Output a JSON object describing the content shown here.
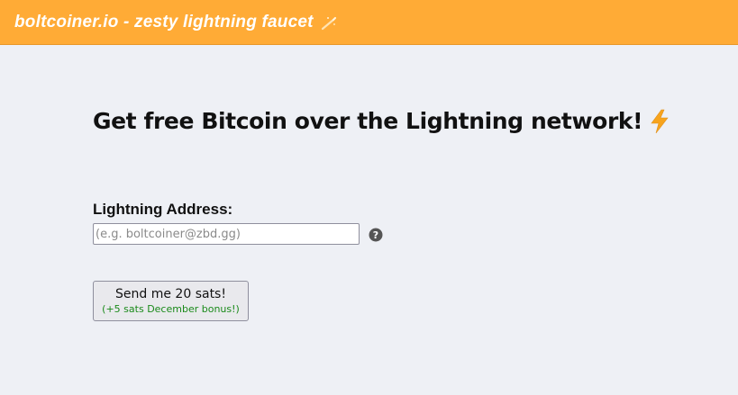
{
  "header": {
    "brand_text": "boltcoiner.io - zesty lightning faucet",
    "brand_icon": "wand-icon",
    "background_color": "#ffab36"
  },
  "main": {
    "headline": "Get free Bitcoin over the Lightning network!",
    "headline_icon": "lightning-bolt-icon",
    "form": {
      "address_label": "Lightning Address:",
      "address_value": "",
      "address_placeholder": "(e.g. boltcoiner@zbd.gg)",
      "help_icon": "question-circle-icon",
      "submit_label": "Send me 20 sats!",
      "bonus_label": "(+5 sats December bonus!)",
      "bonus_color": "#1a8a1a"
    }
  }
}
